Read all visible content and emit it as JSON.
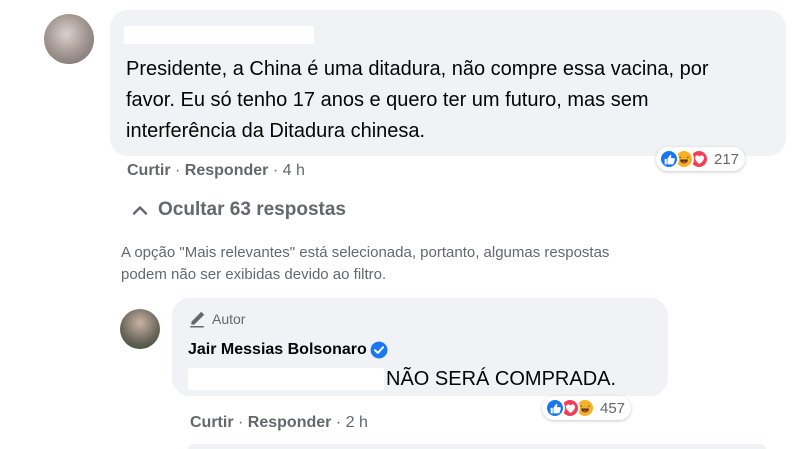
{
  "comment": {
    "text": "Presidente, a China é uma ditadura, não compre essa vacina, por favor. Eu só tenho 17 anos e quero ter um futuro, mas sem interferência da Ditadura chinesa.",
    "actions": {
      "like": "Curtir",
      "sep": "·",
      "reply": "Responder",
      "time": "4 h"
    },
    "reactions": {
      "count": "217",
      "icons": [
        "like-icon",
        "haha-icon",
        "love-icon"
      ]
    }
  },
  "replies_toggle": {
    "label": "Ocultar 63 respostas"
  },
  "filter_notice": {
    "line1": "A opção \"Mais relevantes\" está selecionada, portanto, algumas respostas",
    "line2": "podem não ser exibidas devido ao filtro."
  },
  "reply": {
    "badge": "Autor",
    "author": "Jair Messias Bolsonaro",
    "text": "NÃO SERÁ COMPRADA.",
    "actions": {
      "like": "Curtir",
      "sep": "·",
      "reply": "Responder",
      "time": "2 h"
    },
    "reactions": {
      "count": "457",
      "icons": [
        "like-icon",
        "love-icon",
        "haha-icon"
      ]
    }
  },
  "colors": {
    "like": "#1877f2",
    "love": "#f33e58",
    "haha": "#f7b125",
    "bubble": "#f0f2f5",
    "meta_text": "#65676b"
  }
}
